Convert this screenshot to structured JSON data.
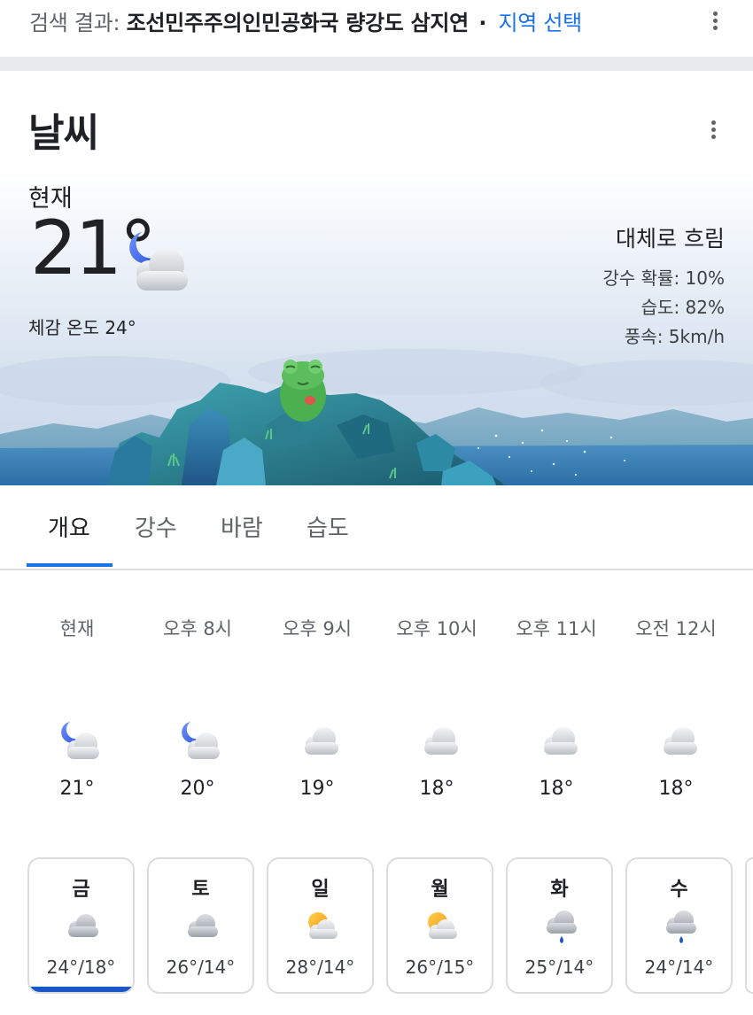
{
  "search": {
    "prefix": "검색 결과:",
    "location": "조선민주주의인민공화국 량강도 삼지연",
    "separator": "·",
    "region_link": "지역 선택"
  },
  "weather": {
    "title": "날씨",
    "now_label": "현재",
    "temperature": "21°",
    "feels_like": "체감 온도 24°",
    "condition": "대체로 흐림",
    "precip": "강수 확률: 10%",
    "humidity": "습도: 82%",
    "wind": "풍속: 5km/h",
    "current_icon": "moon-cloud-icon"
  },
  "tabs": [
    {
      "label": "개요",
      "active": true
    },
    {
      "label": "강수",
      "active": false
    },
    {
      "label": "바람",
      "active": false
    },
    {
      "label": "습도",
      "active": false
    }
  ],
  "hourly": [
    {
      "time": "현재",
      "temp": "21°",
      "icon": "moon-cloud-icon"
    },
    {
      "time": "오후 8시",
      "temp": "20°",
      "icon": "moon-cloud-icon"
    },
    {
      "time": "오후 9시",
      "temp": "19°",
      "icon": "cloud-icon"
    },
    {
      "time": "오후 10시",
      "temp": "18°",
      "icon": "cloud-icon"
    },
    {
      "time": "오후 11시",
      "temp": "18°",
      "icon": "cloud-icon"
    },
    {
      "time": "오전 12시",
      "temp": "18°",
      "icon": "cloud-icon"
    }
  ],
  "daily": [
    {
      "day": "금",
      "range": "24°/18°",
      "icon": "cloud-icon",
      "active": true
    },
    {
      "day": "토",
      "range": "26°/14°",
      "icon": "cloud-icon",
      "active": false
    },
    {
      "day": "일",
      "range": "28°/14°",
      "icon": "sun-cloud-icon",
      "active": false
    },
    {
      "day": "월",
      "range": "26°/15°",
      "icon": "sun-cloud-icon",
      "active": false
    },
    {
      "day": "화",
      "range": "25°/14°",
      "icon": "rain-cloud-icon",
      "active": false
    },
    {
      "day": "수",
      "range": "24°/14°",
      "icon": "rain-cloud-icon",
      "active": false
    }
  ],
  "colors": {
    "accent": "#1a73e8",
    "active_bar": "#1a56c8",
    "text": "#202124",
    "secondary": "#5f6368"
  }
}
